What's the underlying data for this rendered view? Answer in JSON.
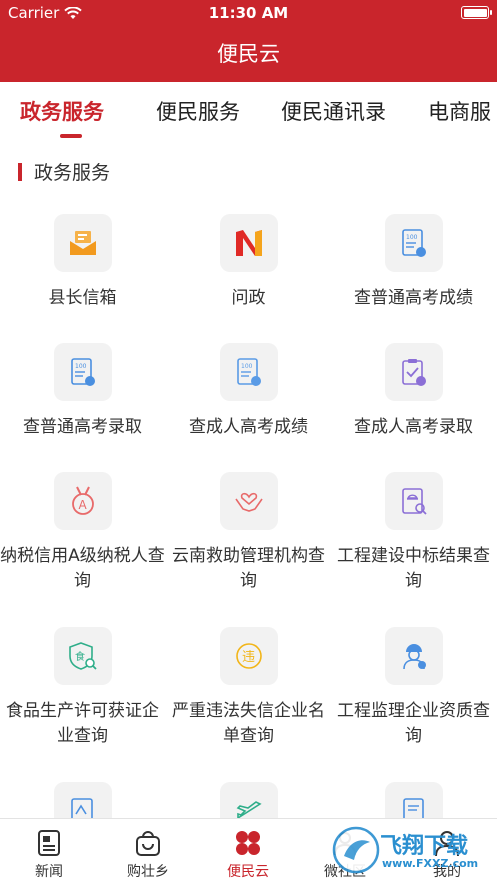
{
  "status_bar": {
    "carrier": "Carrier",
    "time": "11:30 AM"
  },
  "header": {
    "title": "便民云"
  },
  "tabs": [
    {
      "label": "政务服务",
      "active": true
    },
    {
      "label": "便民服务",
      "active": false
    },
    {
      "label": "便民通讯录",
      "active": false
    },
    {
      "label": "电商服",
      "active": false
    }
  ],
  "section": {
    "title": "政务服务"
  },
  "services": [
    {
      "label": "县长信箱",
      "icon": "mailbox-icon"
    },
    {
      "label": "问政",
      "icon": "wenzheng-logo-icon"
    },
    {
      "label": "查普通高考成绩",
      "icon": "score-sheet-icon"
    },
    {
      "label": "查普通高考录取",
      "icon": "score-sheet-icon"
    },
    {
      "label": "查成人高考成绩",
      "icon": "score-sheet-icon"
    },
    {
      "label": "查成人高考录取",
      "icon": "clipboard-check-icon"
    },
    {
      "label": "纳税信用A级纳税人查询",
      "icon": "medal-a-icon"
    },
    {
      "label": "云南救助管理机构查询",
      "icon": "helping-hands-icon"
    },
    {
      "label": "工程建设中标结果查询",
      "icon": "engineering-search-icon"
    },
    {
      "label": "食品生产许可获证企业查询",
      "icon": "food-shield-icon"
    },
    {
      "label": "严重违法失信企业名单查询",
      "icon": "violation-badge-icon"
    },
    {
      "label": "工程监理企业资质查询",
      "icon": "worker-icon"
    },
    {
      "label": "",
      "icon": "document-icon"
    },
    {
      "label": "",
      "icon": "plane-icon"
    },
    {
      "label": "",
      "icon": "document-icon"
    }
  ],
  "tab_bar": [
    {
      "label": "新闻",
      "icon": "news-icon",
      "active": false
    },
    {
      "label": "购壮乡",
      "icon": "shopping-bag-icon",
      "active": false
    },
    {
      "label": "便民云",
      "icon": "clover-icon",
      "active": true
    },
    {
      "label": "微社区",
      "icon": "community-icon",
      "active": false
    },
    {
      "label": "我的",
      "icon": "profile-icon",
      "active": false
    }
  ],
  "watermark": {
    "text": "飞翔下载",
    "url": "www.FXXZ.com"
  },
  "colors": {
    "brand_red": "#c9252c"
  }
}
